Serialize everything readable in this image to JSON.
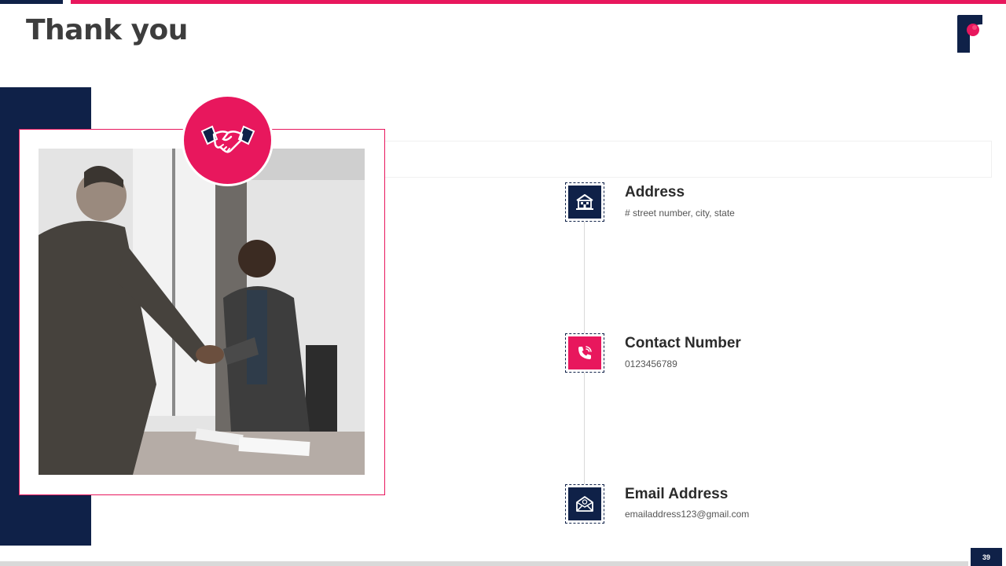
{
  "slide": {
    "title": "Thank you",
    "page_number": "39"
  },
  "colors": {
    "accent": "#e8175d",
    "navy": "#0f2148",
    "text": "#3d3d3d"
  },
  "contacts": [
    {
      "heading": "Address",
      "detail": "# street number, city, state",
      "icon": "building-icon"
    },
    {
      "heading": "Contact Number",
      "detail": "0123456789",
      "icon": "phone-icon"
    },
    {
      "heading": "Email Address",
      "detail": "emailaddress123@gmail.com",
      "icon": "email-icon"
    }
  ],
  "image": {
    "icon": "handshake-icon"
  }
}
